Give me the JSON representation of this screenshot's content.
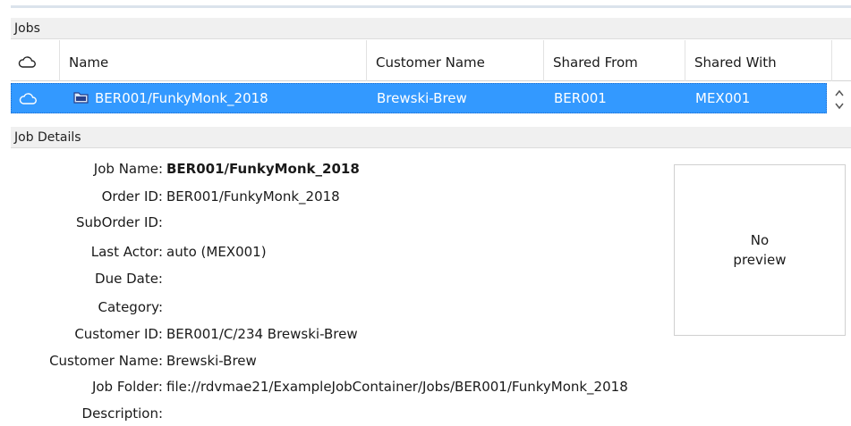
{
  "jobs_section": {
    "title": "Jobs",
    "columns": [
      "Name",
      "Customer Name",
      "Shared From",
      "Shared With"
    ],
    "cloud_icon": "cloud-icon",
    "rows": [
      {
        "name": "BER001/FunkyMonk_2018",
        "customer_name": "Brewski-Brew",
        "shared_from": "BER001",
        "shared_with": "MEX001",
        "icon": "folder-icon",
        "selected": true
      }
    ]
  },
  "details_section": {
    "title": "Job Details",
    "fields": [
      {
        "label": "Job Name:",
        "value": "BER001/FunkyMonk_2018"
      },
      {
        "label": "Order ID:",
        "value": "BER001/FunkyMonk_2018"
      },
      {
        "label": "SubOrder ID:",
        "value": ""
      },
      {
        "label": "Last Actor:",
        "value": "auto (MEX001)"
      },
      {
        "label": "Due Date:",
        "value": ""
      },
      {
        "label": "Category:",
        "value": ""
      },
      {
        "label": "Customer ID:",
        "value": "BER001/C/234 Brewski-Brew"
      },
      {
        "label": "Customer Name:",
        "value": "Brewski-Brew"
      },
      {
        "label": "Job Folder:",
        "value": "file://rdvmae21/ExampleJobContainer/Jobs/BER001/FunkyMonk_2018"
      },
      {
        "label": "Description:",
        "value": ""
      }
    ],
    "preview": {
      "line1": "No",
      "line2": "preview"
    }
  },
  "colors": {
    "selection": "#3399ff",
    "header_bg": "#f0f0f0"
  }
}
